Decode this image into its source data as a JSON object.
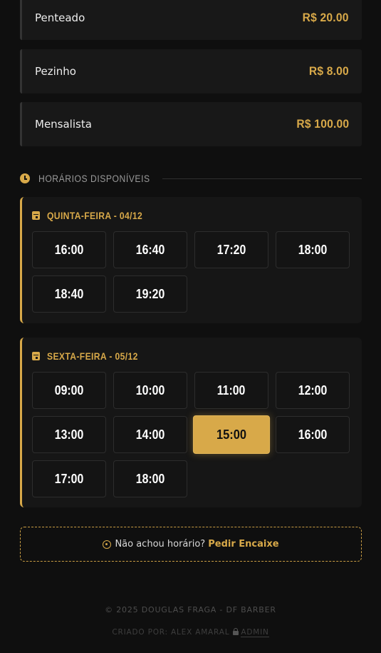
{
  "services": [
    {
      "name": "Penteado",
      "price": "R$ 20.00"
    },
    {
      "name": "Pezinho",
      "price": "R$ 8.00"
    },
    {
      "name": "Mensalista",
      "price": "R$ 100.00"
    }
  ],
  "schedule": {
    "icon": "clock-icon",
    "title": "HORÁRIOS DISPONÍVEIS",
    "days": [
      {
        "label": "QUINTA-FEIRA - 04/12",
        "slots": [
          "16:00",
          "16:40",
          "17:20",
          "18:00",
          "18:40",
          "19:20"
        ]
      },
      {
        "label": "SEXTA-FEIRA - 05/12",
        "slots": [
          "09:00",
          "10:00",
          "11:00",
          "12:00",
          "13:00",
          "14:00",
          "15:00",
          "16:00",
          "17:00",
          "18:00"
        ],
        "selected": "15:00"
      }
    ]
  },
  "encaixe": {
    "icon": "whatsapp-icon",
    "question": "Não achou horário?",
    "action": "Pedir Encaixe"
  },
  "footer": {
    "copyright": "© 2025 DOUGLAS FRAGA - DF BARBER",
    "credit": "CRIADO POR: ALEX AMARAL",
    "admin_label": "ADMIN"
  },
  "colors": {
    "accent": "#d8a949",
    "background": "#0f0f0f",
    "card": "#161616"
  }
}
